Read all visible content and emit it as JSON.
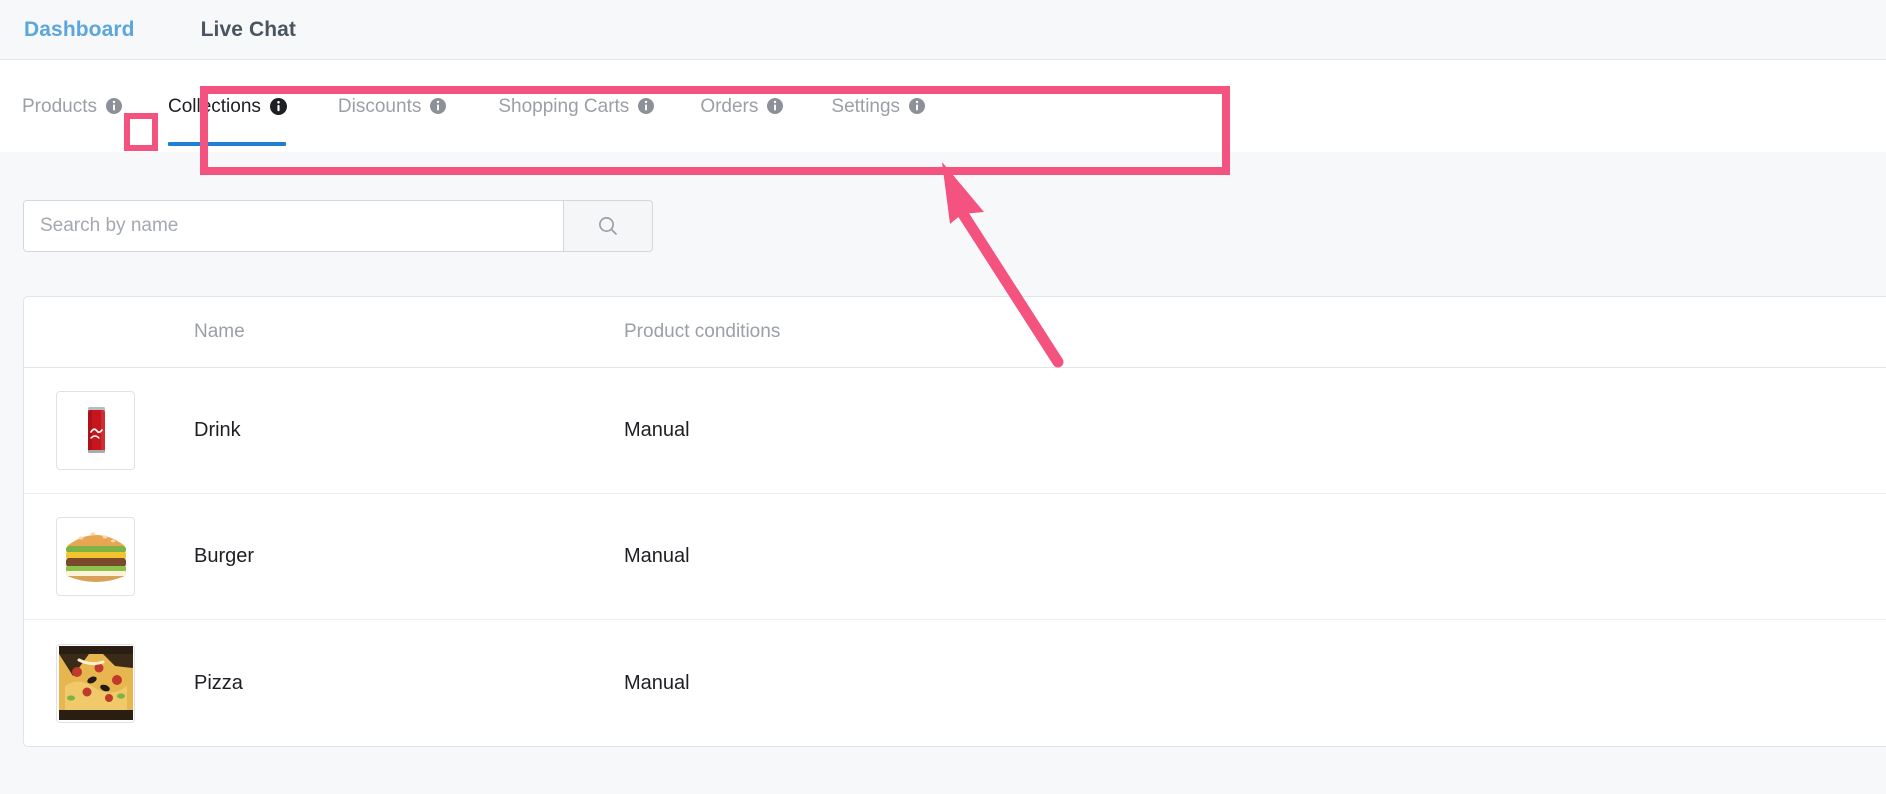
{
  "top_nav": {
    "items": [
      {
        "label": "Dashboard",
        "active": true
      },
      {
        "label": "Live Chat",
        "active": false
      }
    ]
  },
  "tabs": [
    {
      "key": "products",
      "label": "Products",
      "active": false,
      "has_info_icon": true,
      "info_icon": "info-icon"
    },
    {
      "key": "collections",
      "label": "Collections",
      "active": true,
      "has_info_icon": true,
      "info_icon": "info-icon"
    },
    {
      "key": "discounts",
      "label": "Discounts",
      "active": false,
      "has_info_icon": true,
      "info_icon": "info-icon"
    },
    {
      "key": "shopping-carts",
      "label": "Shopping Carts",
      "active": false,
      "has_info_icon": true,
      "info_icon": "info-icon"
    },
    {
      "key": "orders",
      "label": "Orders",
      "active": false,
      "has_info_icon": true,
      "info_icon": "info-icon"
    },
    {
      "key": "settings",
      "label": "Settings",
      "active": false,
      "has_info_icon": true,
      "info_icon": "info-icon"
    }
  ],
  "search": {
    "placeholder": "Search by name",
    "value": "",
    "button_icon": "search-icon"
  },
  "table": {
    "columns": [
      "",
      "Name",
      "Product conditions"
    ],
    "headers": {
      "thumbnail": "",
      "name": "Name",
      "conditions": "Product conditions"
    },
    "rows": [
      {
        "thumbnail": "soda-can-image",
        "name": "Drink",
        "conditions": "Manual"
      },
      {
        "thumbnail": "burger-image",
        "name": "Burger",
        "conditions": "Manual"
      },
      {
        "thumbnail": "pizza-image",
        "name": "Pizza",
        "conditions": "Manual"
      }
    ]
  },
  "annotations": {
    "accent_color": "#f4527f",
    "highlight_tabs_group": "Collections / Discounts / Shopping Carts / Orders / Settings",
    "highlight_products_info_icon": "Products info icon",
    "arrow": "arrow-pointing-up-left"
  },
  "colors": {
    "page_background": "#f7f8fa",
    "panel_background": "#ffffff",
    "active_nav": "#5aa6dd",
    "active_tab_underline": "#1e7fd4",
    "muted_text": "#9b9fa6",
    "body_text": "#1d1f23",
    "border": "#e1e4e8",
    "annotation_pink": "#f4527f"
  }
}
